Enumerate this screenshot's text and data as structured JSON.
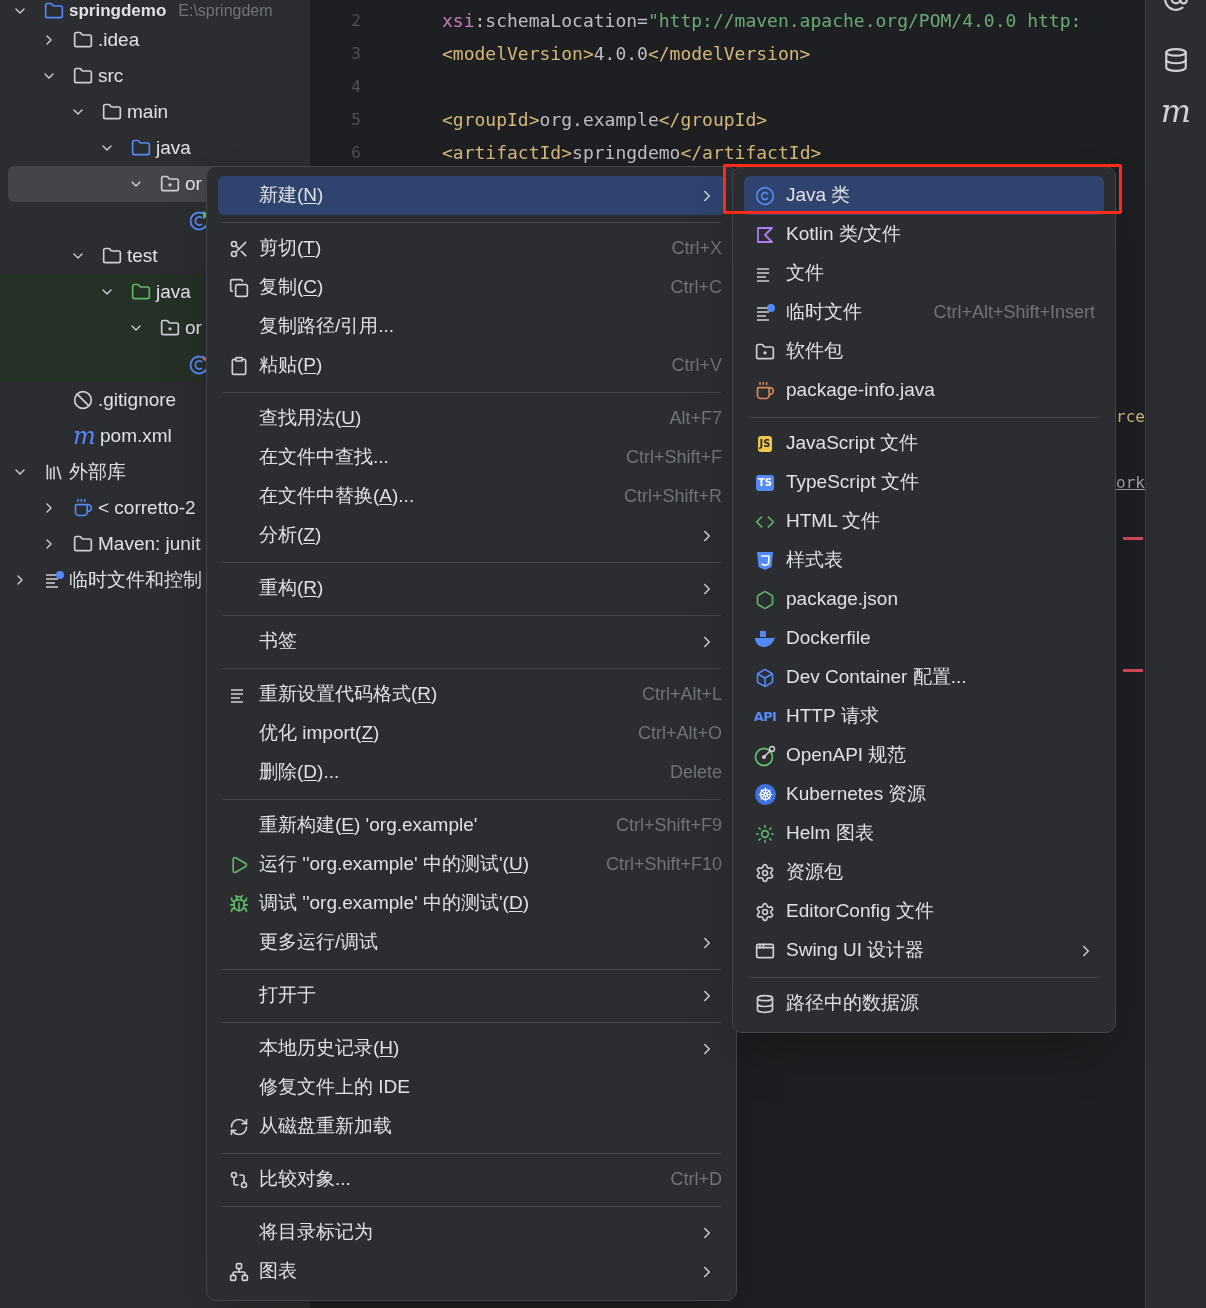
{
  "project_tree": [
    {
      "label": "springdemo",
      "path": "E:\\springdem",
      "kind": "module",
      "expanded": true,
      "selected": false,
      "children": [
        {
          "label": ".idea",
          "kind": "folder",
          "expanded": false,
          "selected": false
        },
        {
          "label": "src",
          "kind": "folder",
          "expanded": true,
          "selected": false,
          "children": [
            {
              "label": "main",
              "kind": "folder",
              "expanded": true,
              "selected": false,
              "children": [
                {
                  "label": "java",
                  "kind": "source",
                  "expanded": true,
                  "selected": false,
                  "children": [
                    {
                      "label": "or",
                      "kind": "package",
                      "expanded": true,
                      "selected": true,
                      "children": [
                        {
                          "kind": "mainclass",
                          "selected": false
                        }
                      ]
                    }
                  ]
                }
              ]
            },
            {
              "label": "test",
              "kind": "folder",
              "expanded": true,
              "selected": false,
              "children": [
                {
                  "label": "java",
                  "kind": "testsource",
                  "expanded": true,
                  "selected": false,
                  "children": [
                    {
                      "label": "or",
                      "kind": "package",
                      "expanded": true,
                      "selected": false,
                      "children": [
                        {
                          "kind": "testclass",
                          "selected": false
                        }
                      ]
                    }
                  ]
                }
              ]
            }
          ]
        },
        {
          "label": ".gitignore",
          "kind": "ignore",
          "selected": false
        },
        {
          "label": "pom.xml",
          "kind": "maven",
          "glyph": "m",
          "selected": false
        }
      ]
    },
    {
      "label": "外部库",
      "kind": "library",
      "expanded": true,
      "selected": false,
      "children": [
        {
          "label": "< corretto-2",
          "kind": "jdk",
          "expanded": false,
          "selected": false
        },
        {
          "label": "Maven: junit",
          "kind": "lib",
          "expanded": false,
          "selected": false
        }
      ]
    },
    {
      "label": "临时文件和控制",
      "kind": "scratch",
      "expanded": false,
      "selected": false
    }
  ],
  "editor": {
    "lines": [
      {
        "number": "2",
        "tokens": [
          {
            "text": "xsi",
            "kind": "ns"
          },
          {
            "text": ":schemaLocation=",
            "kind": "plain"
          },
          {
            "text": "\"http://maven.apache.org/POM/4.0.0 http:",
            "kind": "string"
          }
        ]
      },
      {
        "number": "3",
        "tokens": [
          {
            "text": "<modelVersion>",
            "kind": "tag"
          },
          {
            "text": "4.0.0",
            "kind": "plain"
          },
          {
            "text": "</modelVersion>",
            "kind": "tag"
          }
        ]
      },
      {
        "number": "4"
      },
      {
        "number": "5",
        "tokens": [
          {
            "text": "<groupId>",
            "kind": "tag"
          },
          {
            "text": "org.example",
            "kind": "plain"
          },
          {
            "text": "</groupId>",
            "kind": "tag"
          }
        ]
      },
      {
        "number": "6",
        "tokens": [
          {
            "text": "<artifactId>",
            "kind": "tag"
          },
          {
            "text": "springdemo",
            "kind": "plain"
          },
          {
            "text": "</artifactId>",
            "kind": "tag"
          }
        ]
      }
    ],
    "fragments": [
      {
        "text": "rce",
        "kind": "tag"
      },
      {
        "text": "ork",
        "kind": "link"
      }
    ]
  },
  "right_toolbar": {
    "maven_glyph": "m"
  },
  "context_menu": {
    "groups": [
      [
        {
          "label": "新建(",
          "mnemonic": "N",
          "after": ")",
          "submenu": true,
          "selected": true
        }
      ],
      [
        {
          "label": "剪切(",
          "mnemonic": "T",
          "after": ")",
          "shortcut": "Ctrl+X",
          "submenu": false,
          "selected": false
        },
        {
          "label": "复制(",
          "mnemonic": "C",
          "after": ")",
          "shortcut": "Ctrl+C",
          "submenu": false,
          "selected": false
        },
        {
          "label": "复制路径/引用...",
          "submenu": false,
          "selected": false
        },
        {
          "label": "粘贴(",
          "mnemonic": "P",
          "after": ")",
          "shortcut": "Ctrl+V",
          "submenu": false,
          "selected": false
        }
      ],
      [
        {
          "label": "查找用法(",
          "mnemonic": "U",
          "after": ")",
          "shortcut": "Alt+F7",
          "submenu": false,
          "selected": false
        },
        {
          "label": "在文件中查找...",
          "shortcut": "Ctrl+Shift+F",
          "submenu": false,
          "selected": false
        },
        {
          "label": "在文件中替换(",
          "mnemonic": "A",
          "after": ")...",
          "shortcut": "Ctrl+Shift+R",
          "submenu": false,
          "selected": false
        },
        {
          "label": "分析(",
          "mnemonic": "Z",
          "after": ")",
          "submenu": true,
          "selected": false
        }
      ],
      [
        {
          "label": "重构(",
          "mnemonic": "R",
          "after": ")",
          "submenu": true,
          "selected": false
        }
      ],
      [
        {
          "label": "书签",
          "submenu": true,
          "selected": false
        }
      ],
      [
        {
          "label": "重新设置代码格式(",
          "mnemonic": "R",
          "after": ")",
          "shortcut": "Ctrl+Alt+L",
          "submenu": false,
          "selected": false
        },
        {
          "label": "优化 import(",
          "mnemonic": "Z",
          "after": ")",
          "shortcut": "Ctrl+Alt+O",
          "submenu": false,
          "selected": false
        },
        {
          "label": "删除(",
          "mnemonic": "D",
          "after": ")...",
          "shortcut": "Delete",
          "submenu": false,
          "selected": false
        }
      ],
      [
        {
          "label": "重新构建(",
          "mnemonic": "E",
          "after": ") 'org.example'",
          "shortcut": "Ctrl+Shift+F9",
          "submenu": false,
          "selected": false
        },
        {
          "label": "运行 ''org.example' 中的测试'(",
          "mnemonic": "U",
          "after": ")",
          "shortcut": "Ctrl+Shift+F10",
          "submenu": false,
          "selected": false
        },
        {
          "label": "调试 ''org.example' 中的测试'(",
          "mnemonic": "D",
          "after": ")",
          "submenu": false,
          "selected": false
        },
        {
          "label": "更多运行/调试",
          "submenu": true,
          "selected": false
        }
      ],
      [
        {
          "label": "打开于",
          "submenu": true,
          "selected": false
        }
      ],
      [
        {
          "label": "本地历史记录(",
          "mnemonic": "H",
          "after": ")",
          "submenu": true,
          "selected": false
        },
        {
          "label": "修复文件上的 IDE",
          "submenu": false,
          "selected": false
        },
        {
          "label": "从磁盘重新加载",
          "submenu": false,
          "selected": false
        }
      ],
      [
        {
          "label": "比较对象...",
          "shortcut": "Ctrl+D",
          "submenu": false,
          "selected": false
        }
      ],
      [
        {
          "label": "将目录标记为",
          "submenu": true,
          "selected": false
        },
        {
          "label": "图表",
          "submenu": true,
          "selected": false
        }
      ]
    ]
  },
  "new_submenu": {
    "groups": [
      [
        {
          "label": "Java 类",
          "submenu": false,
          "selected": true
        },
        {
          "label": "Kotlin 类/文件",
          "submenu": false,
          "selected": false
        },
        {
          "label": "文件",
          "submenu": false,
          "selected": false
        },
        {
          "label": "临时文件",
          "shortcut": "Ctrl+Alt+Shift+Insert",
          "submenu": false,
          "selected": false
        },
        {
          "label": "软件包",
          "submenu": false,
          "selected": false
        },
        {
          "label": "package-info.java",
          "submenu": false,
          "selected": false
        }
      ],
      [
        {
          "label": "JavaScript 文件",
          "icon_text": "JS",
          "submenu": false,
          "selected": false
        },
        {
          "label": "TypeScript 文件",
          "icon_text": "TS",
          "submenu": false,
          "selected": false
        },
        {
          "label": "HTML 文件",
          "submenu": false,
          "selected": false
        },
        {
          "label": "样式表",
          "submenu": false,
          "selected": false
        },
        {
          "label": "package.json",
          "submenu": false,
          "selected": false
        },
        {
          "label": "Dockerfile",
          "submenu": false,
          "selected": false
        },
        {
          "label": "Dev Container 配置...",
          "submenu": false,
          "selected": false
        },
        {
          "label": "HTTP 请求",
          "icon_text": "API",
          "submenu": false,
          "selected": false
        },
        {
          "label": "OpenAPI 规范",
          "submenu": false,
          "selected": false
        },
        {
          "label": "Kubernetes 资源",
          "submenu": false,
          "selected": false
        },
        {
          "label": "Helm 图表",
          "submenu": false,
          "selected": false
        },
        {
          "label": "资源包",
          "submenu": false,
          "selected": false
        },
        {
          "label": "EditorConfig 文件",
          "submenu": false,
          "selected": false
        },
        {
          "label": "Swing UI 设计器",
          "submenu": true,
          "selected": false
        }
      ],
      [
        {
          "label": "路径中的数据源",
          "submenu": false,
          "selected": false
        }
      ]
    ]
  }
}
